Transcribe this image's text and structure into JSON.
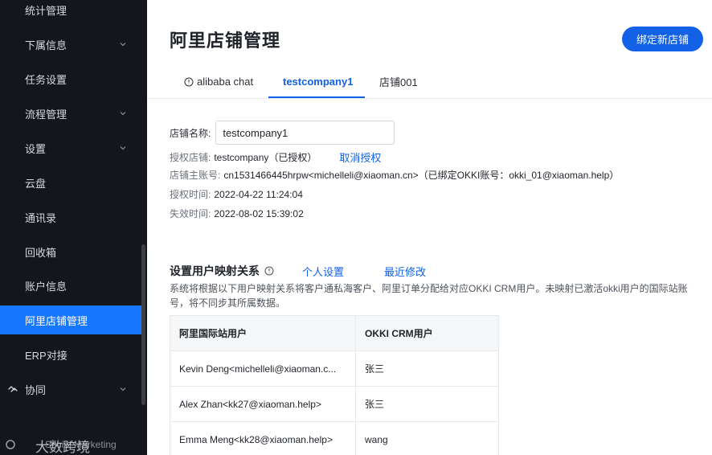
{
  "sidebar": {
    "items": [
      {
        "label": "统计管理",
        "chevron": false
      },
      {
        "label": "下属信息",
        "chevron": true
      },
      {
        "label": "任务设置",
        "chevron": false
      },
      {
        "label": "流程管理",
        "chevron": true
      },
      {
        "label": "设置",
        "chevron": true
      },
      {
        "label": "云盘",
        "chevron": false
      },
      {
        "label": "通讯录",
        "chevron": false
      },
      {
        "label": "回收箱",
        "chevron": false
      },
      {
        "label": "账户信息",
        "chevron": false
      },
      {
        "label": "阿里店铺管理",
        "chevron": false,
        "active": true
      },
      {
        "label": "ERP对接",
        "chevron": false
      },
      {
        "label": "协同",
        "chevron": true,
        "icon": "collab-icon"
      }
    ],
    "watermark_big": "大数跨境",
    "watermark_small": "Social Marketing"
  },
  "header": {
    "title": "阿里店铺管理",
    "bind_button": "绑定新店铺"
  },
  "tabs": [
    {
      "label": "alibaba chat",
      "icon": "info-circle-icon"
    },
    {
      "label": "testcompany1",
      "active": true
    },
    {
      "label": "店铺001"
    }
  ],
  "store": {
    "name_label": "店铺名称:",
    "name_value": "testcompany1",
    "auth_store_label": "授权店铺:",
    "auth_store_value": "testcompany（已授权）",
    "cancel_auth": "取消授权",
    "main_account_label": "店铺主账号:",
    "main_account_value": "cn1531466445hrpw<michelleli@xiaoman.cn>（已绑定OKKI账号：okki_01@xiaoman.help）",
    "auth_time_label": "授权时间:",
    "auth_time_value": "2022-04-22 11:24:04",
    "expire_time_label": "失效时间:",
    "expire_time_value": "2022-08-02 15:39:02"
  },
  "mapping": {
    "title": "设置用户映射关系",
    "personal_settings": "个人设置",
    "recent_changes": "最近修改",
    "description": "系统将根据以下用户映射关系将客户通私海客户、阿里订单分配给对应OKKI CRM用户。未映射已激活okki用户的国际站账号，将不同步其所属数据。",
    "columns": [
      "阿里国际站用户",
      "OKKI CRM用户"
    ],
    "rows": [
      [
        "Kevin Deng<michelleli@xiaoman.c...",
        "张三"
      ],
      [
        "Alex Zhan<kk27@xiaoman.help>",
        "张三"
      ],
      [
        "Emma Meng<kk28@xiaoman.help>",
        "wang"
      ]
    ]
  },
  "colors": {
    "sidebar_bg": "#14161b",
    "accent": "#1261e6",
    "active_item": "#1677ff"
  }
}
